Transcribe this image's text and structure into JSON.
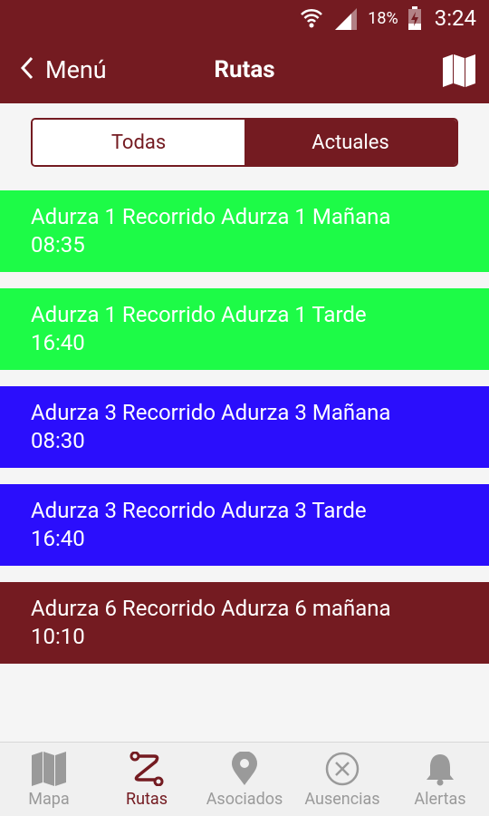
{
  "status_bar": {
    "battery_percent": "18%",
    "time": "3:24",
    "icons": [
      "wifi-icon",
      "signal-icon",
      "battery-charging-icon"
    ]
  },
  "header": {
    "back_label": "Menú",
    "title": "Rutas",
    "map_icon": "map-icon"
  },
  "tabs": {
    "items": [
      {
        "label": "Todas",
        "selected": false
      },
      {
        "label": "Actuales",
        "selected": true
      }
    ]
  },
  "routes": [
    {
      "name": "Adurza 1 Recorrido Adurza 1 Mañana",
      "time": "08:35",
      "color": "#1dfb47"
    },
    {
      "name": "Adurza 1 Recorrido Adurza 1 Tarde",
      "time": "16:40",
      "color": "#1dfb47"
    },
    {
      "name": "Adurza 3 Recorrido Adurza 3 Mañana",
      "time": "08:30",
      "color": "#2b0efc"
    },
    {
      "name": "Adurza 3 Recorrido Adurza 3 Tarde",
      "time": "16:40",
      "color": "#2b0efc"
    },
    {
      "name": "Adurza 6 Recorrido Adurza 6 mañana",
      "time": "10:10",
      "color": "#741b21"
    }
  ],
  "bottom_nav": {
    "active": "Rutas",
    "items": [
      {
        "label": "Mapa",
        "icon": "map-icon"
      },
      {
        "label": "Rutas",
        "icon": "route-icon"
      },
      {
        "label": "Asociados",
        "icon": "location-pin-icon"
      },
      {
        "label": "Ausencias",
        "icon": "cancel-circle-icon"
      },
      {
        "label": "Alertas",
        "icon": "bell-icon"
      }
    ]
  },
  "colors": {
    "brand": "#741b21",
    "route_green": "#1dfb47",
    "route_blue": "#2b0efc",
    "nav_inactive": "#9a9a9a"
  }
}
